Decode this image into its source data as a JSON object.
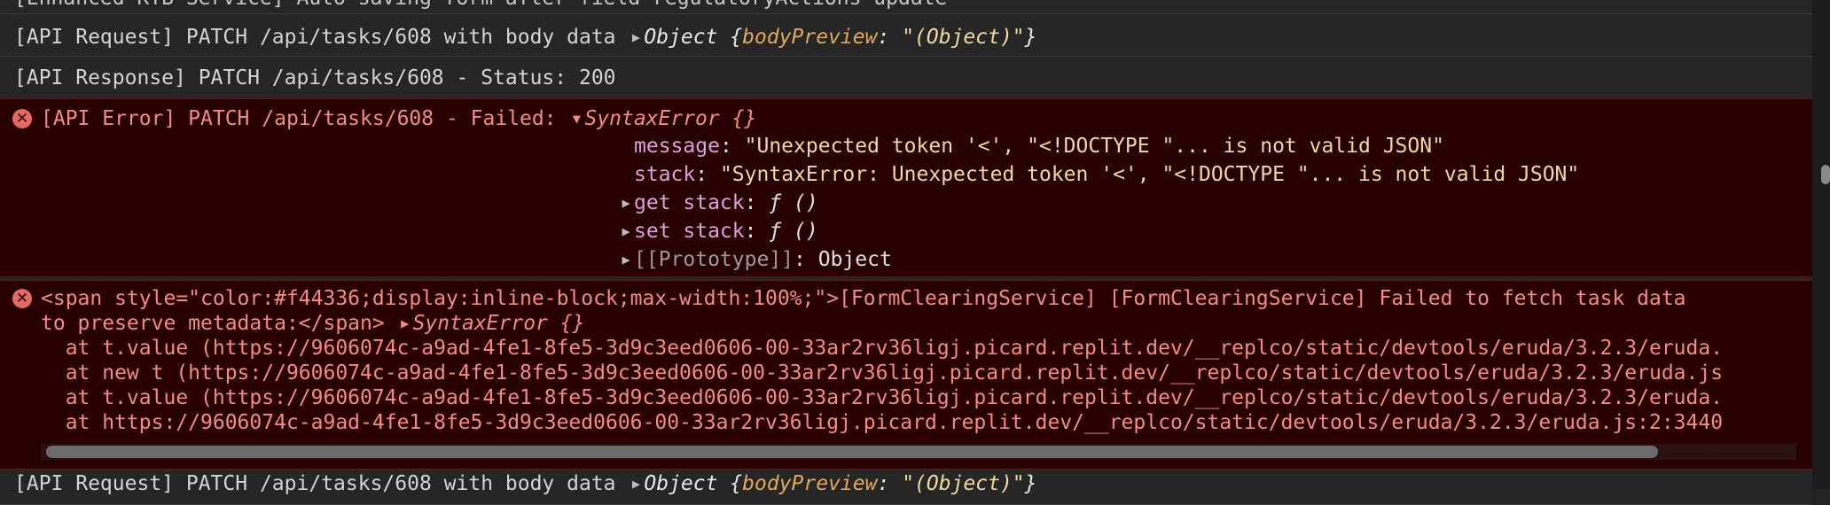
{
  "colors": {
    "background": "#242424",
    "error_background": "#290000",
    "error_text": "#f28b82",
    "property_name": "#d8a0df",
    "string_value": "#f0d9a0",
    "italic_key": "#e2a85c"
  },
  "rows": {
    "top_partial": "[Enhanced KYB Service] Auto-saving form after field regulatoryActions update",
    "api_request_1": {
      "text": "[API Request] PATCH /api/tasks/608 with body data ",
      "object_label": "Object ",
      "brace_open": "{",
      "key": "bodyPreview",
      "colon": ": ",
      "value": "\"(Object)\"",
      "brace_close": "}"
    },
    "api_response": "[API Response] PATCH /api/tasks/608 - Status: 200",
    "api_error": {
      "text": "[API Error] PATCH /api/tasks/608 - Failed: ",
      "error_object": "SyntaxError {}",
      "props": {
        "message_key": "message",
        "message_value": "\"Unexpected token '<', \"<!DOCTYPE \"... is not valid JSON\"",
        "stack_key": "stack",
        "stack_value": "\"SyntaxError: Unexpected token '<', \"<!DOCTYPE \"... is not valid JSON\"",
        "get_stack_key": "get stack",
        "get_stack_value": "ƒ ()",
        "set_stack_key": "set stack",
        "set_stack_value": "ƒ ()",
        "prototype_key": "[[Prototype]]",
        "prototype_value": "Object"
      }
    },
    "form_clearing": {
      "line1": "<span style=\"color:#f44336;display:inline-block;max-width:100%;\">[FormClearingService] [FormClearingService] Failed to fetch task data",
      "line2": "to preserve metadata:</span> ",
      "error_object": "SyntaxError {}",
      "trace": [
        "  at t.value (https://9606074c-a9ad-4fe1-8fe5-3d9c3eed0606-00-33ar2rv36ligj.picard.replit.dev/__replco/static/devtools/eruda/3.2.3/eruda.",
        "  at new t (https://9606074c-a9ad-4fe1-8fe5-3d9c3eed0606-00-33ar2rv36ligj.picard.replit.dev/__replco/static/devtools/eruda/3.2.3/eruda.js",
        "  at t.value (https://9606074c-a9ad-4fe1-8fe5-3d9c3eed0606-00-33ar2rv36ligj.picard.replit.dev/__replco/static/devtools/eruda/3.2.3/eruda.",
        "  at https://9606074c-a9ad-4fe1-8fe5-3d9c3eed0606-00-33ar2rv36ligj.picard.replit.dev/__replco/static/devtools/eruda/3.2.3/eruda.js:2:3440"
      ]
    },
    "api_request_2": {
      "text": "[API Request] PATCH /api/tasks/608 with body data ",
      "object_label": "Object ",
      "brace_open": "{",
      "key": "bodyPreview",
      "colon": ": ",
      "value": "\"(Object)\"",
      "brace_close": "}"
    }
  },
  "icons": {
    "error": "close-circle-icon",
    "collapsed": "triangle-right-icon",
    "expanded": "triangle-down-icon"
  }
}
